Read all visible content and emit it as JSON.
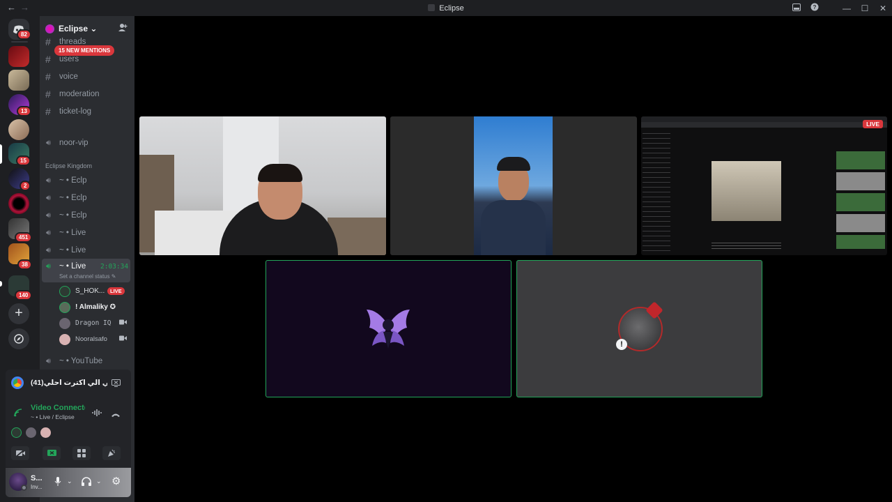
{
  "window": {
    "title": "Eclipse",
    "nav_back": "←",
    "nav_fwd": "→"
  },
  "servers": {
    "home_badge": "82",
    "badges": [
      "13",
      "15",
      "2",
      "451",
      "38",
      "140"
    ]
  },
  "guild": {
    "name": "Eclipse",
    "chevron": "⌄",
    "new_mentions": "15 NEW MENTIONS"
  },
  "channels": {
    "text": [
      {
        "label": "threads"
      },
      {
        "label": "users"
      },
      {
        "label": "voice"
      },
      {
        "label": "moderation"
      },
      {
        "label": "ticket-log"
      }
    ],
    "voice_top": "noor-vip",
    "category": "Eclipse Kingdom",
    "voice": [
      {
        "label": "~ • Eclp"
      },
      {
        "label": "~ • Eclp"
      },
      {
        "label": "~ • Eclp"
      },
      {
        "label": "~ • Live"
      },
      {
        "label": "~ • Live"
      }
    ],
    "active": {
      "label": "~ • Live",
      "timer": "2:03:34",
      "status": "Set a channel status"
    },
    "members": [
      {
        "name": "S_HOK...",
        "badge": "LIVE"
      },
      {
        "name": "! Almaliky ✪"
      },
      {
        "name": "Dragon IQ"
      },
      {
        "name": "Nooralsafo"
      }
    ],
    "youtube": "~ • YouTube"
  },
  "activity": {
    "title": "(41)ذني الي اكترت احلي ..."
  },
  "voice_panel": {
    "status": "Video Connected",
    "channel": "~ • Live / Eclipse"
  },
  "account": {
    "name": "S...",
    "status": "Inv..."
  },
  "tiles": {
    "live_label": "LIVE"
  },
  "colors": {
    "accent_green": "#23a55a",
    "live_red": "#da373c",
    "sidebar": "#2b2d31",
    "rail": "#1e1f22"
  }
}
